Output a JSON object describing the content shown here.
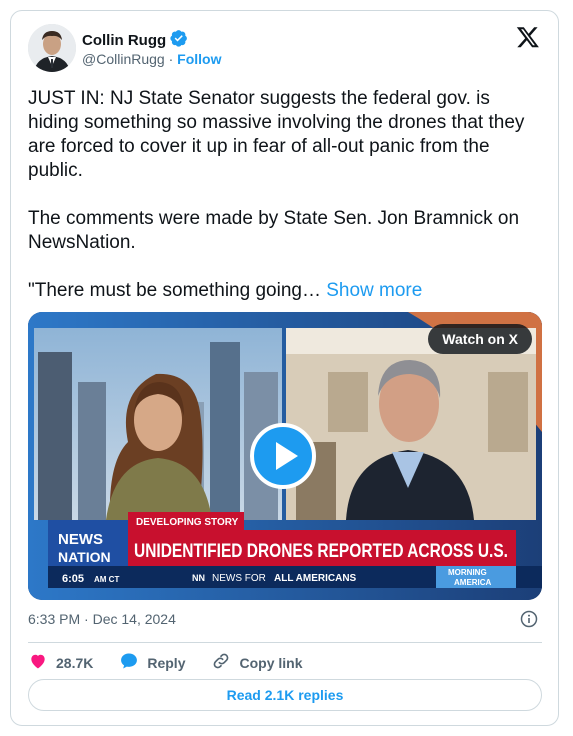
{
  "author": {
    "name": "Collin Rugg",
    "handle": "@CollinRugg",
    "separator": "·",
    "follow_label": "Follow"
  },
  "tweet": {
    "text": "JUST IN: NJ State Senator suggests the federal gov. is hiding something so massive involving the drones that they are forced to cover it up in fear of all-out panic from the public.\n\nThe comments were made by State Sen. Jon Bramnick on NewsNation.\n\n\"There must be something going…",
    "show_more_label": "Show more"
  },
  "media": {
    "watch_label": "Watch on X",
    "lower_third": {
      "tag": "DEVELOPING STORY",
      "headline": "UNIDENTIFIED DRONES REPORTED ACROSS U.S.",
      "logo_line1": "NEWS",
      "logo_line2": "NATION",
      "time": "6:05",
      "time_suffix": "AM CT",
      "ticker_badge": "NN",
      "ticker_prefix": "NEWS FOR ",
      "ticker_bold": "ALL AMERICANS",
      "show_line1": "MORNING",
      "show_line2": "AMERICA"
    }
  },
  "meta": {
    "timestamp": "6:33 PM · Dec 14, 2024"
  },
  "actions": {
    "likes": "28.7K",
    "reply_label": "Reply",
    "copy_label": "Copy link"
  },
  "read_replies_label": "Read 2.1K replies",
  "colors": {
    "accent": "#1d9bf0",
    "like": "#f91880",
    "headline_red": "#c8102e",
    "news_blue": "#1f4fa3"
  },
  "icons": [
    "verified-badge-icon",
    "x-logo-icon",
    "play-icon",
    "info-icon",
    "heart-icon",
    "reply-bubble-icon",
    "link-icon"
  ]
}
